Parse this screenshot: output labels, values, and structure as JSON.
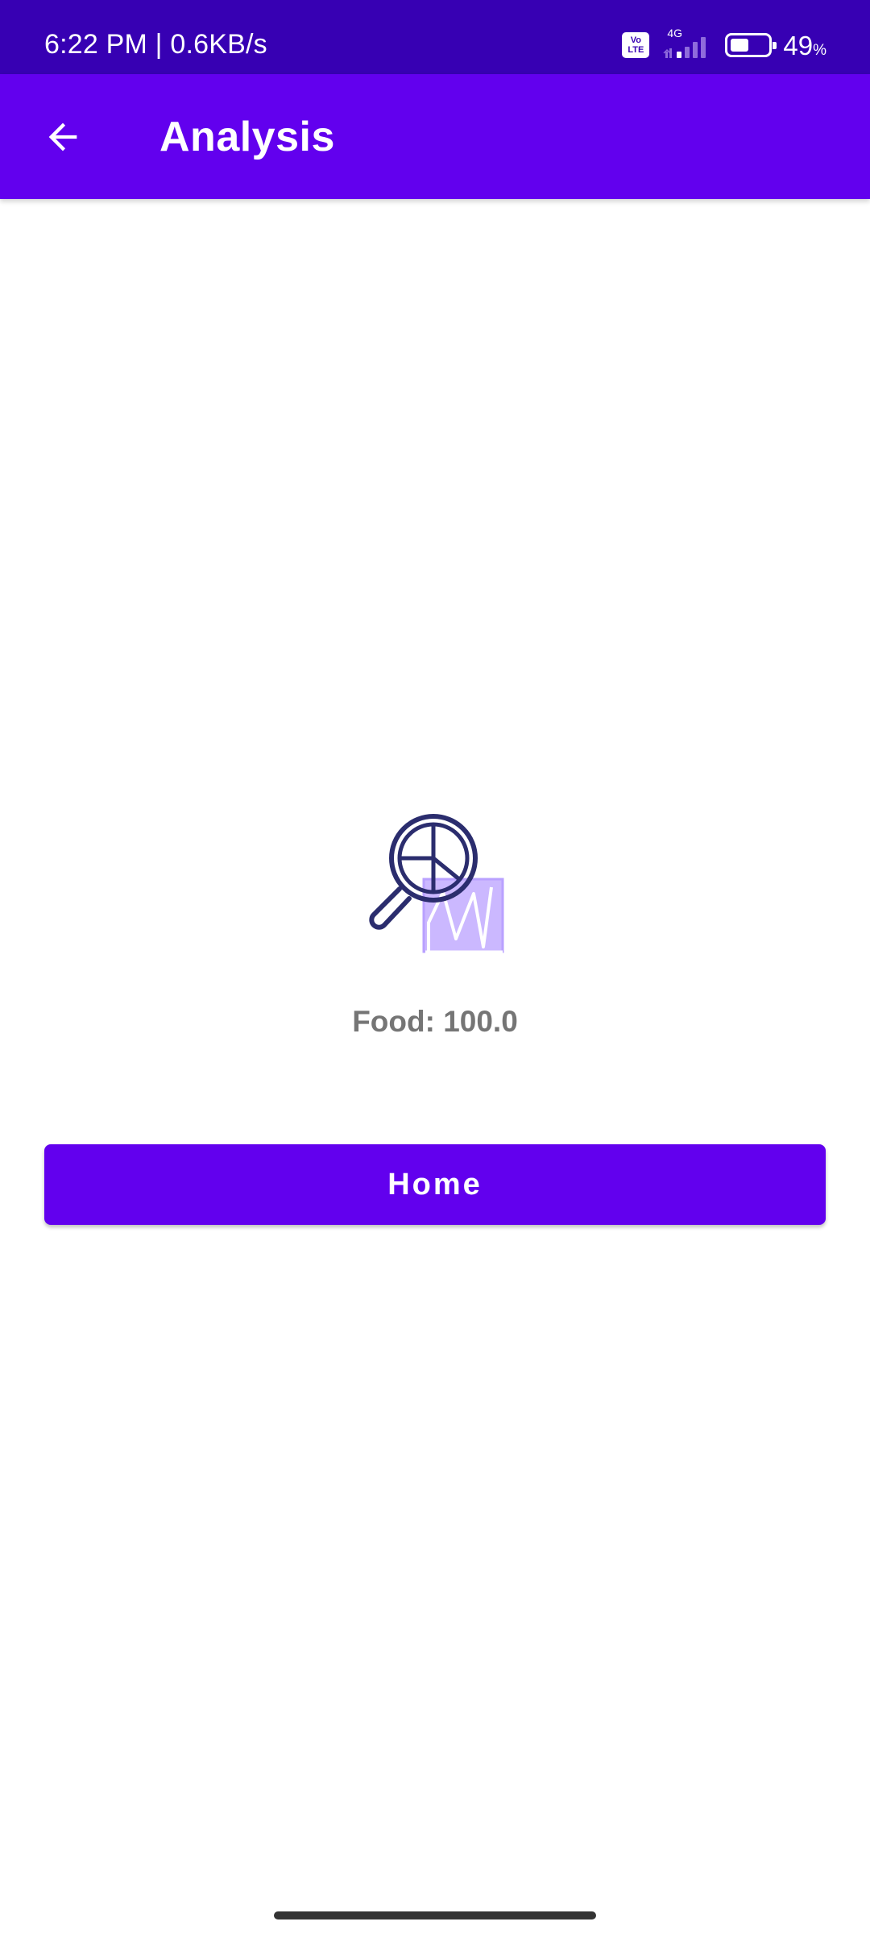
{
  "status_bar": {
    "time_speed": "6:22 PM | 0.6KB/s",
    "volte_label": "Vo LTE",
    "network_type": "4G",
    "battery_level": "49",
    "battery_unit": "%",
    "battery_fraction": 0.49,
    "icons": [
      "volte-icon",
      "signal-icon",
      "battery-icon"
    ]
  },
  "app_bar": {
    "title": "Analysis",
    "back_icon": "arrow-left-icon"
  },
  "content": {
    "illustration_icon": "magnifier-chart-icon",
    "result_text": "Food: 100.0",
    "home_button_label": "Home"
  },
  "colors": {
    "status_bar_bg": "#3700b3",
    "app_bar_bg": "#6200ee",
    "primary": "#6200ee",
    "result_text": "#757575",
    "icon_stroke": "#2b2d6e",
    "icon_accent": "#c9b5ff"
  }
}
